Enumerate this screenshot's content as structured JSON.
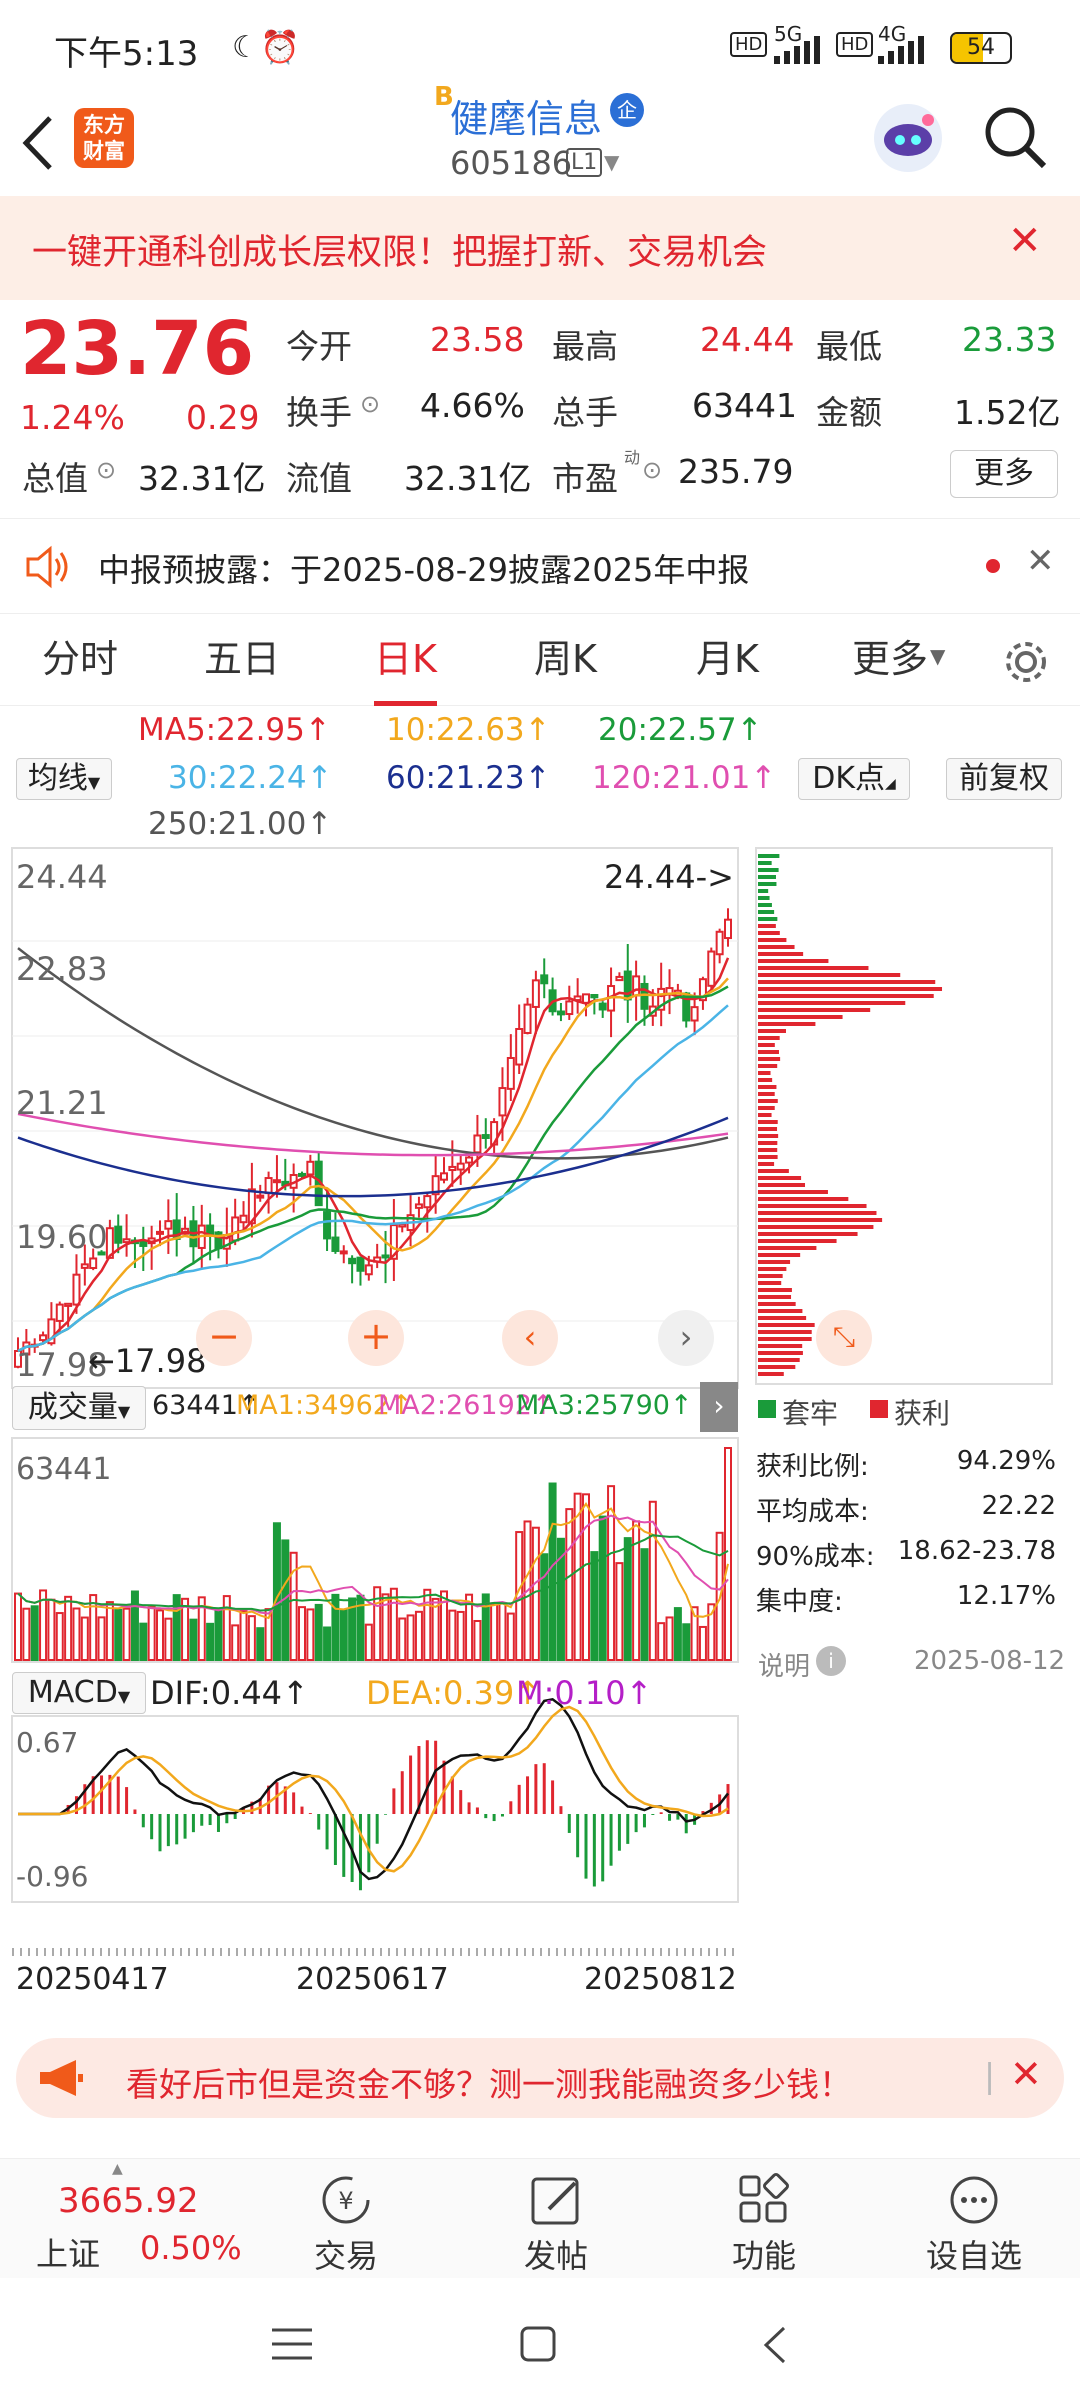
{
  "status": {
    "time": "下午5:13",
    "net1": "5G",
    "net2": "4G",
    "battery": "54"
  },
  "header": {
    "logo_line1": "东方",
    "logo_line2": "财富",
    "badge": "B",
    "name": "健麾信息",
    "name_tag": "企",
    "code": "605186",
    "level": "L1"
  },
  "banner": {
    "text": "一键开通科创成长层权限！把握打新、交易机会"
  },
  "quote": {
    "price": "23.76",
    "change_pct": "1.24%",
    "change": "0.29",
    "open_label": "今开",
    "open": "23.58",
    "high_label": "最高",
    "high": "24.44",
    "low_label": "最低",
    "low": "23.33",
    "turnover_label": "换手",
    "turnover": "4.66%",
    "volume_label": "总手",
    "volume": "63441",
    "amount_label": "金额",
    "amount": "1.52亿",
    "mcap_label": "总值",
    "mcap": "32.31亿",
    "float_label": "流值",
    "float": "32.31亿",
    "pe_label": "市盈",
    "pe_sup": "动",
    "pe": "235.79",
    "more_label": "更多"
  },
  "notice": {
    "text": "中报预披露：于2025-08-29披露2025年中报"
  },
  "tabs": [
    "分时",
    "五日",
    "日K",
    "周K",
    "月K",
    "更多"
  ],
  "ma": {
    "ma5": "MA5:22.95↑",
    "ma10": "10:22.63↑",
    "ma20": "20:22.57↑",
    "ma30": "30:22.24↑",
    "ma60": "60:21.23↑",
    "ma120": "120:21.01↑",
    "ma250": "250:21.00↑",
    "selector": "均线",
    "dk": "DK点",
    "adjust": "前复权"
  },
  "colors": {
    "up": "#e0262f",
    "down": "#1a9b3a",
    "ma5": "#e0262f",
    "ma10": "#f2a81d",
    "ma20": "#1a9b3a",
    "ma30": "#4ab4e6",
    "ma60": "#1b2f8f",
    "ma120": "#e04fb0",
    "ma250": "#555555"
  },
  "chart_data": {
    "type": "candlestick",
    "price_axis": [
      "24.44",
      "22.83",
      "21.21",
      "19.60",
      "17.98"
    ],
    "max_marker": "24.44->",
    "min_marker": "←17.98",
    "ylim": [
      17.98,
      24.44
    ],
    "vol_label": "成交量",
    "vol_top": "63441",
    "vol_ma": [
      "63441↑",
      "MA1:34962↑",
      "MA2:26192↑",
      "MA3:25790↑"
    ],
    "macd_label": "MACD",
    "dif": "DIF:0.44↑",
    "dea": "DEA:0.39↑",
    "m": "M:0.10↑",
    "macd_axis": [
      "0.67",
      "-0.96"
    ],
    "dates": [
      "20250417",
      "20250617",
      "20250812"
    ],
    "legend_hold": "套牢",
    "legend_profit": "获利"
  },
  "chips": {
    "rows": [
      {
        "label": "获利比例:",
        "value": "94.29%"
      },
      {
        "label": "平均成本:",
        "value": "22.22"
      },
      {
        "label": "90%成本:",
        "value": "18.62-23.78"
      },
      {
        "label": "集中度:",
        "value": "12.17%"
      }
    ],
    "note_label": "说明",
    "date": "2025-08-12"
  },
  "ad": {
    "text": "看好后市但是资金不够？测一测我能融资多少钱！"
  },
  "bottom": {
    "index_value": "3665.92",
    "index_name": "上证",
    "index_change": "0.50%",
    "trade": "交易",
    "post": "发帖",
    "func": "功能",
    "watch": "设自选"
  }
}
